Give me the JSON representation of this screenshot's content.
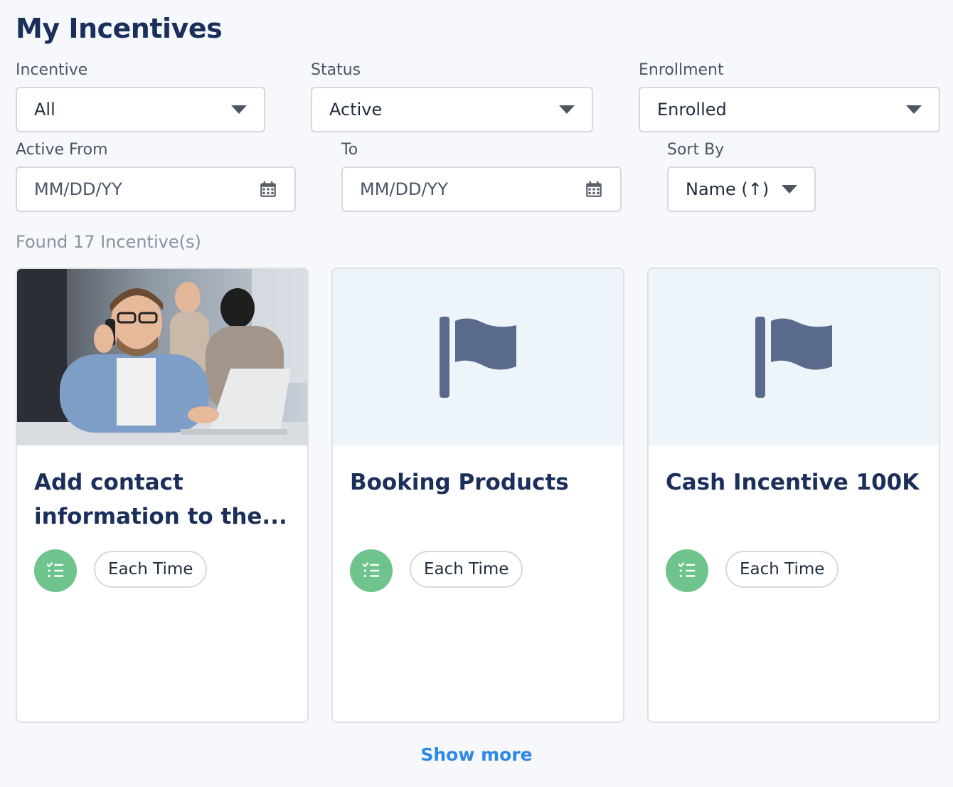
{
  "page": {
    "title": "My Incentives"
  },
  "filters": {
    "incentive": {
      "label": "Incentive",
      "value": "All"
    },
    "status": {
      "label": "Status",
      "value": "Active"
    },
    "enrollment": {
      "label": "Enrollment",
      "value": "Enrolled"
    },
    "active_from": {
      "label": "Active From",
      "placeholder": "MM/DD/YY"
    },
    "to": {
      "label": "To",
      "placeholder": "MM/DD/YY"
    },
    "sort_by": {
      "label": "Sort By",
      "value": "Name (↑)"
    }
  },
  "results": {
    "summary": "Found 17 Incentive(s)"
  },
  "cards": [
    {
      "title": "Add contact information to the...",
      "media": "photo",
      "frequency": "Each Time",
      "icon": "checklist-icon"
    },
    {
      "title": "Booking Products",
      "media": "flag-icon",
      "frequency": "Each Time",
      "icon": "checklist-icon"
    },
    {
      "title": "Cash Incentive 100K",
      "media": "flag-icon",
      "frequency": "Each Time",
      "icon": "checklist-icon"
    }
  ],
  "footer": {
    "show_more": "Show more"
  },
  "colors": {
    "title": "#1b2f5b",
    "accent_link": "#2d88e8",
    "badge_green": "#6ec48c",
    "flag": "#5a6a8c",
    "media_bg": "#eef5fa"
  }
}
